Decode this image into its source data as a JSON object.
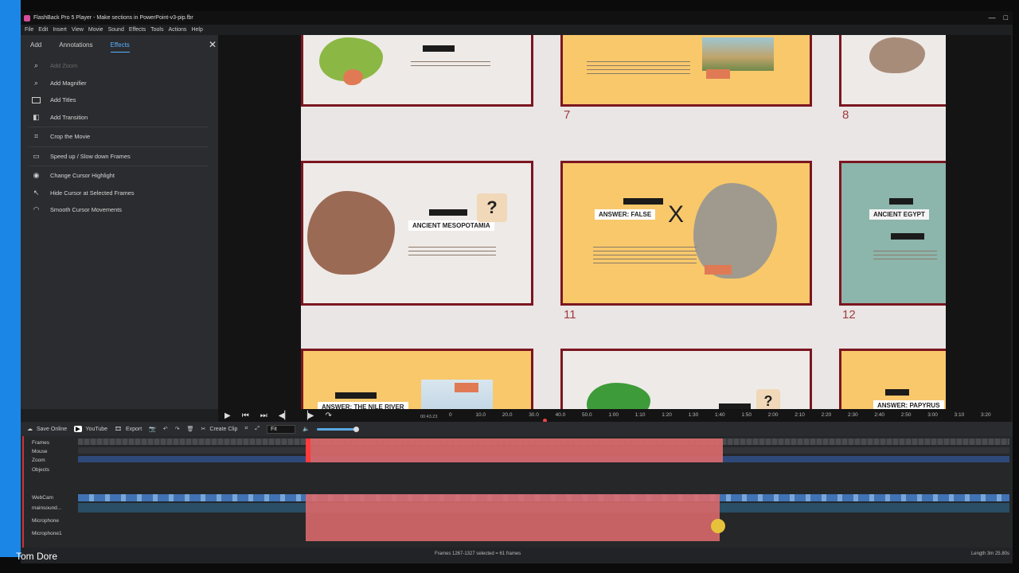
{
  "window": {
    "title": "FlashBack Pro 5 Player - Make sections in PowerPoint-v3-pip.fbr",
    "controls": [
      "—",
      "□"
    ]
  },
  "menu": [
    "File",
    "Edit",
    "Insert",
    "View",
    "Movie",
    "Sound",
    "Effects",
    "Tools",
    "Actions",
    "Help"
  ],
  "panel": {
    "tabs": [
      "Add",
      "Annotations",
      "Effects"
    ],
    "close": "✕",
    "effects": [
      {
        "label": "Add Zoom",
        "icon": "zoom-icon",
        "disabled": true
      },
      {
        "label": "Add Magnifier",
        "icon": "magnifier-icon"
      },
      {
        "label": "Add Titles",
        "icon": "titles-icon"
      },
      {
        "label": "Add Transition",
        "icon": "transition-icon"
      },
      {
        "label": "Crop the Movie",
        "icon": "crop-icon"
      },
      {
        "label": "Speed up / Slow down Frames",
        "icon": "speed-icon"
      },
      {
        "label": "Change Cursor Highlight",
        "icon": "cursor-highlight-icon"
      },
      {
        "label": "Hide Cursor at Selected Frames",
        "icon": "hide-cursor-icon"
      },
      {
        "label": "Smooth Cursor Movements",
        "icon": "smooth-cursor-icon"
      }
    ]
  },
  "slides": {
    "numbers": [
      "7",
      "8",
      "11",
      "12"
    ],
    "titles": [
      "ANCIENT MESOPOTAMIA",
      "ANSWER: FALSE",
      "ANCIENT EGYPT",
      "ANSWER: THE NILE RIVER",
      "ANSWER: PAPYRUS"
    ],
    "mark_x": "X",
    "question": "?"
  },
  "playback": {
    "time": "00:43.23",
    "ticks": [
      "0",
      "10.0",
      "20.0",
      "30.0",
      "40.0",
      "50.0",
      "1:00",
      "1:10",
      "1:20",
      "1:30",
      "1:40",
      "1:50",
      "2:00",
      "2:10",
      "2:20",
      "2:30",
      "2:40",
      "2:50",
      "3:00",
      "3:10",
      "3:20"
    ]
  },
  "toolbar": {
    "save_online": "Save Online",
    "youtube": "YouTube",
    "export": "Export",
    "create_clip": "Create Clip",
    "fit": "Fit",
    "volume_level": 0.85
  },
  "tracks": {
    "labels": [
      "Frames",
      "Mouse",
      "Zoom",
      "Objects",
      "WebCam",
      "mainsound...",
      "Microphone",
      "Microphone1"
    ]
  },
  "status": {
    "selection": "Frames 1267-1327 selected = 61 frames",
    "length": "Length 3m 25.80s"
  },
  "user": "Tom Dore",
  "colors": {
    "accent": "#1c86e6",
    "selection": "#d9696a",
    "slide_border": "#7b1620"
  }
}
